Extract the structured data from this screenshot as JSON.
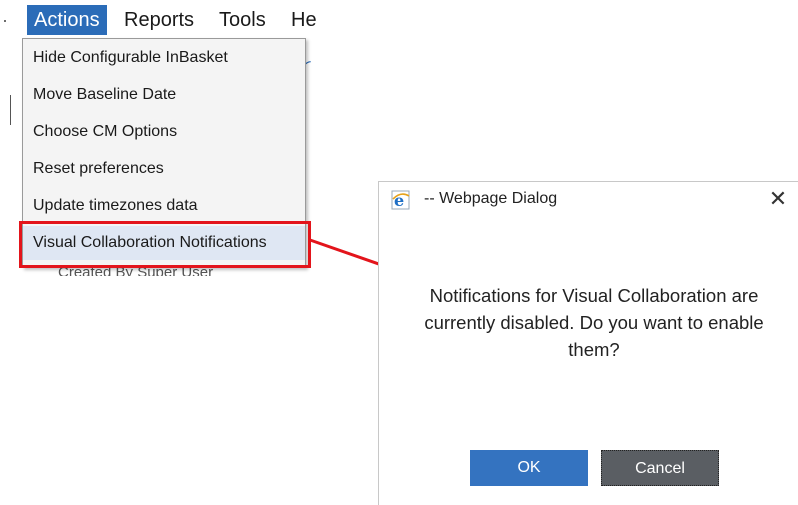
{
  "menubar": {
    "items": [
      {
        "label": "Actions",
        "active": true
      },
      {
        "label": "Reports",
        "active": false
      },
      {
        "label": "Tools",
        "active": false
      },
      {
        "label": "He",
        "active": false
      }
    ]
  },
  "actions_menu": {
    "items": [
      "Hide Configurable InBasket",
      "Move Baseline Date",
      "Choose CM Options",
      "Reset preferences",
      "Update timezones data",
      "Visual Collaboration Notifications"
    ],
    "highlighted_index": 5
  },
  "background_row": "Created By        Super User",
  "dialog": {
    "title": "-- Webpage Dialog",
    "close_glyph": "✕",
    "message": "Notifications for Visual Collaboration are currently disabled. Do you want to enable them?",
    "ok_label": "OK",
    "cancel_label": "Cancel",
    "icon": "ie-icon"
  },
  "colors": {
    "menu_active": "#2b6cb8",
    "highlight_box": "#e3141b",
    "ok_button": "#3473c0",
    "cancel_button": "#5a5e63"
  }
}
